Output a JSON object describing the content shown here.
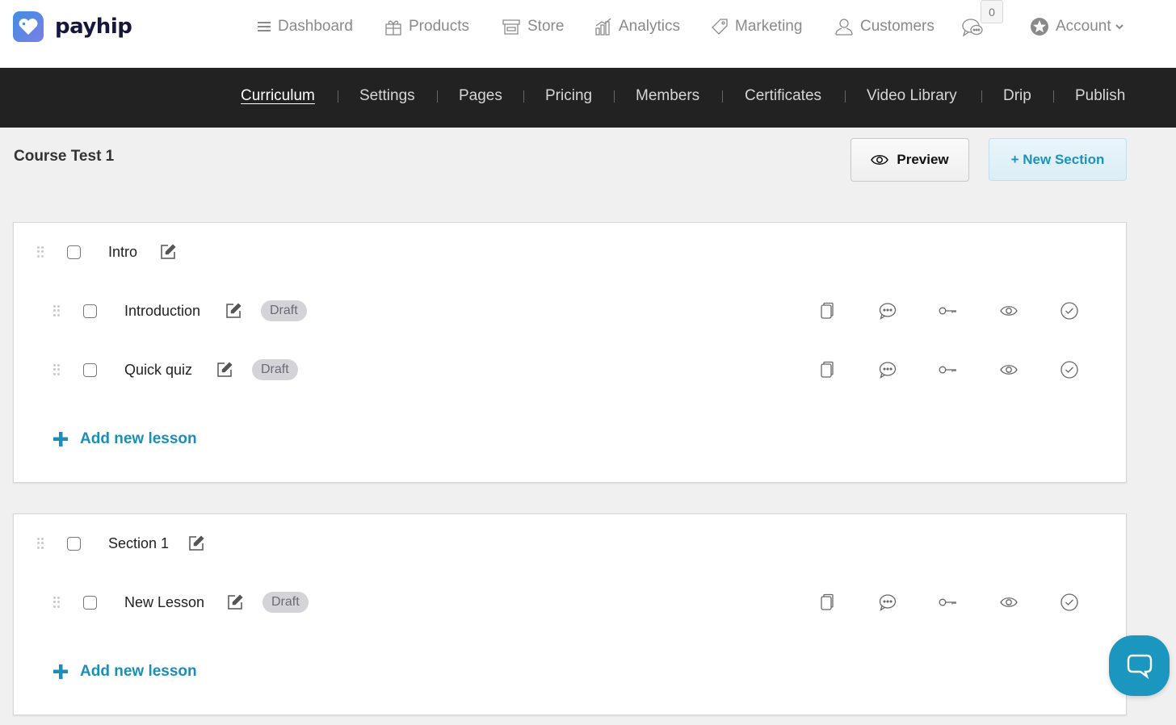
{
  "brand": {
    "name": "payhip",
    "accent": "#1a93bd",
    "subnav_bg": "#222222"
  },
  "topnav": {
    "items": [
      {
        "label": "Dashboard",
        "icon": "menu-icon"
      },
      {
        "label": "Products",
        "icon": "gift-icon"
      },
      {
        "label": "Store",
        "icon": "store-icon"
      },
      {
        "label": "Analytics",
        "icon": "chart-icon"
      },
      {
        "label": "Marketing",
        "icon": "tag-icon"
      },
      {
        "label": "Customers",
        "icon": "user-icon"
      }
    ],
    "messages_count": "0",
    "account_label": "Account"
  },
  "subnav": {
    "items": [
      "Curriculum",
      "Settings",
      "Pages",
      "Pricing",
      "Members",
      "Certificates",
      "Video Library",
      "Drip",
      "Publish"
    ],
    "active": "Curriculum"
  },
  "header": {
    "course_title": "Course Test 1",
    "preview_label": "Preview",
    "new_section_label": "+ New Section"
  },
  "sections": [
    {
      "title": "Intro",
      "lessons": [
        {
          "title": "Introduction",
          "status": "Draft"
        },
        {
          "title": "Quick quiz",
          "status": "Draft"
        }
      ],
      "add_lesson_label": "Add new lesson"
    },
    {
      "title": "Section 1",
      "lessons": [
        {
          "title": "New Lesson",
          "status": "Draft"
        }
      ],
      "add_lesson_label": "Add new lesson"
    }
  ],
  "lesson_actions": [
    "copy-icon",
    "comment-icon",
    "key-icon",
    "eye-icon",
    "check-circle-icon"
  ]
}
